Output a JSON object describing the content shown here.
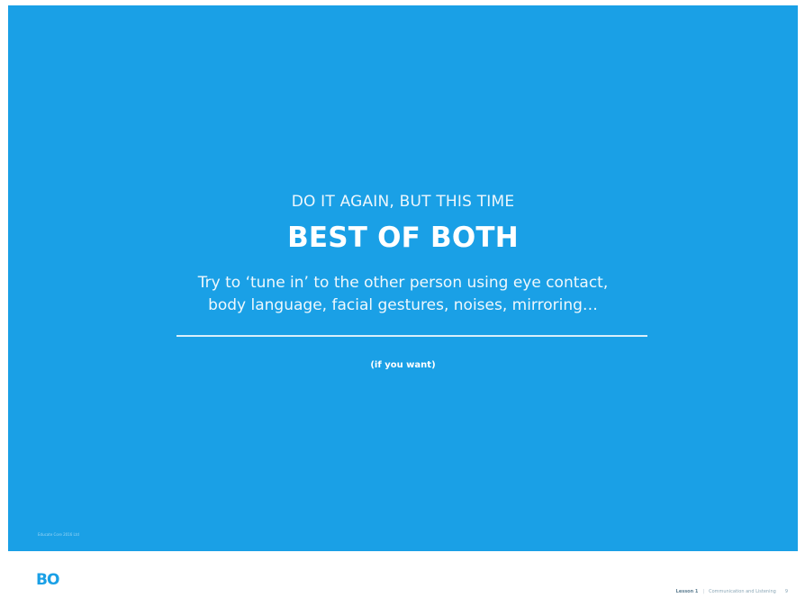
{
  "slide": {
    "kicker": "DO IT AGAIN, BUT THIS TIME",
    "title": "BEST OF BOTH",
    "body_lines": [
      "Try to ‘tune in’ to the other person using eye contact,",
      "body language, facial gestures, noises, mirroring…"
    ],
    "note": "(if you want)",
    "copyright": "Educate Core 2016 Ltd",
    "background_color": "#1aa0e6"
  },
  "footer": {
    "logo_text": "BO",
    "logo_suffix": "",
    "lesson": "Lesson 1",
    "lesson_title": "Communication and Listening",
    "page": "9"
  }
}
